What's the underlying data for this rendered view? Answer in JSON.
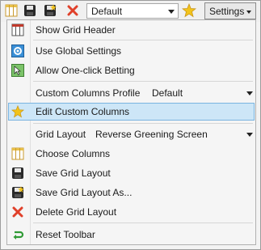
{
  "toolbar": {
    "profile_value": "Default",
    "settings_label": "Settings",
    "icons": [
      "grid-columns-icon",
      "save-icon",
      "save-as-icon",
      "delete-icon",
      "star-icon"
    ]
  },
  "menu": {
    "show_grid_header": "Show Grid Header",
    "use_global_settings": "Use Global Settings",
    "allow_one_click_betting": "Allow One-click Betting",
    "custom_columns_profile_label": "Custom Columns Profile",
    "custom_columns_profile_value": "Default",
    "edit_custom_columns": "Edit Custom Columns",
    "grid_layout_label": "Grid Layout",
    "grid_layout_value": "Reverse Greening Screen",
    "choose_columns": "Choose Columns",
    "save_grid_layout": "Save Grid Layout",
    "save_grid_layout_as": "Save Grid Layout As...",
    "delete_grid_layout": "Delete Grid Layout",
    "reset_toolbar": "Reset Toolbar"
  },
  "colors": {
    "highlight_bg": "#cde6f7",
    "highlight_border": "#7ab4e0",
    "delete_red": "#e0402a",
    "star_yellow": "#f2c31b",
    "reset_green": "#2f9a35"
  }
}
